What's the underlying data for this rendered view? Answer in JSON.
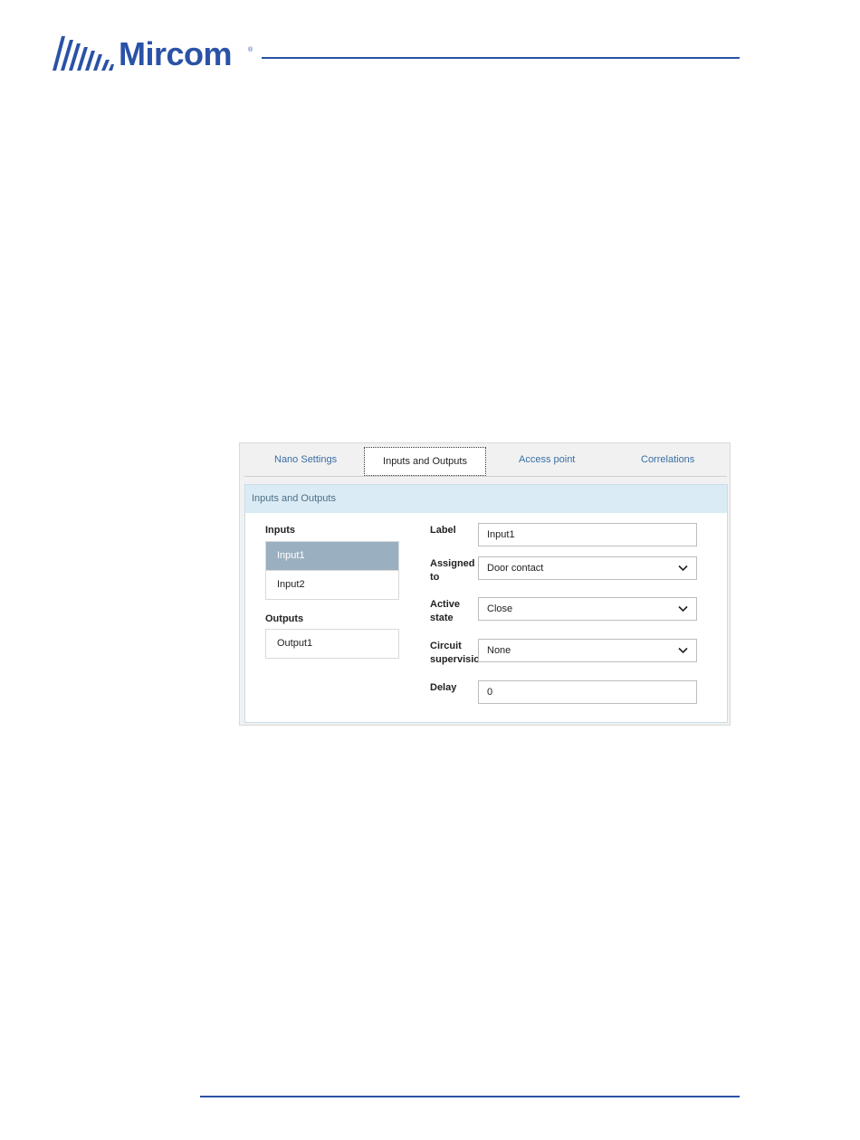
{
  "header": {
    "brand": "Mircom",
    "brand_mark": "®",
    "brand_color": "#2a52a6"
  },
  "tabs": [
    {
      "label": "Nano Settings",
      "active": false
    },
    {
      "label": "Inputs and Outputs",
      "active": true
    },
    {
      "label": "Access point",
      "active": false
    },
    {
      "label": "Correlations",
      "active": false
    }
  ],
  "panel": {
    "title": "Inputs and Outputs",
    "inputs": {
      "heading": "Inputs",
      "items": [
        {
          "label": "Input1",
          "selected": true
        },
        {
          "label": "Input2",
          "selected": false
        }
      ]
    },
    "outputs": {
      "heading": "Outputs",
      "items": [
        {
          "label": "Output1",
          "selected": false
        }
      ]
    },
    "form": {
      "label": {
        "name": "Label",
        "value": "Input1"
      },
      "assigned_to": {
        "name_line1": "Assigned",
        "name_line2": "to",
        "value": "Door contact"
      },
      "active_state": {
        "name_line1": "Active",
        "name_line2": "state",
        "value": "Close"
      },
      "circuit_supervision": {
        "name_line1": "Circuit",
        "name_line2": "supervision",
        "value": "None"
      },
      "delay": {
        "name": "Delay",
        "value": "0"
      }
    }
  },
  "colors": {
    "selected_item": "#9ab0c0",
    "panel_header": "#daebf5",
    "tab_link": "#3a6ea5"
  }
}
